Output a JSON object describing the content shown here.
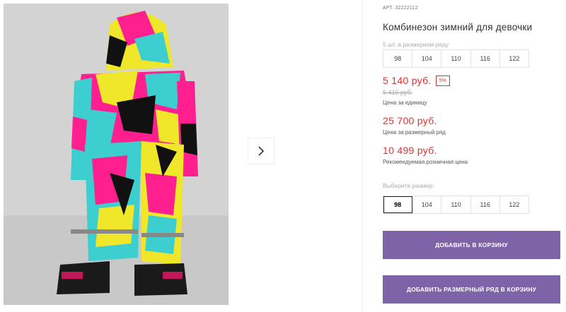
{
  "product": {
    "article_label": "АРТ.",
    "article_value": "32222112",
    "title": "Комбинезон зимний для девочки"
  },
  "range": {
    "label": "5 шт. в размерном ряду",
    "sizes": [
      "98",
      "104",
      "110",
      "116",
      "122"
    ]
  },
  "pricing": {
    "price": "5 140 руб.",
    "discount_badge": "5%",
    "old_price": "5 410 руб.",
    "price_note": "Цена за единицу",
    "range_price": "25 700 руб.",
    "range_note": "Цена за размерный ряд",
    "retail_price": "10 499 руб.",
    "retail_note": "Рекомендуемая розничная цена",
    "accent_color": "#e0322d"
  },
  "size_picker": {
    "label": "Выберите размер:",
    "sizes": [
      "98",
      "104",
      "110",
      "116",
      "122"
    ],
    "selected": "98"
  },
  "actions": {
    "add_to_cart": "ДОБАВИТЬ В КОРЗИНУ",
    "add_range_to_cart": "ДОБАВИТЬ РАЗМЕРНЫЙ РЯД В КОРЗИНУ",
    "button_color": "#7e63a8"
  },
  "gallery": {
    "next_icon": "chevron-right-icon"
  }
}
